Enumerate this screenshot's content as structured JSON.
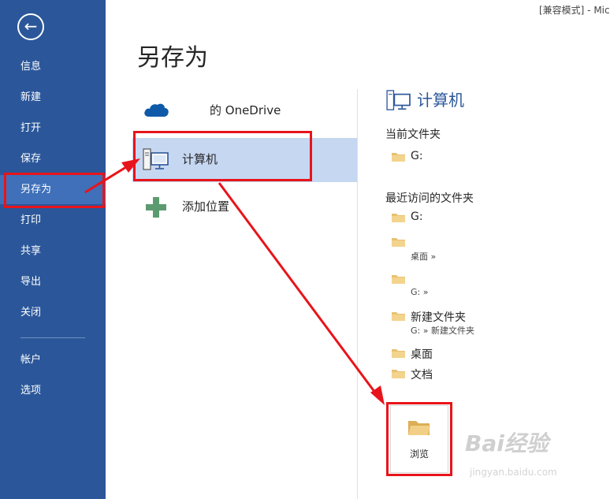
{
  "window": {
    "title": "[兼容模式] - Mic"
  },
  "nav": {
    "back_icon": "back-arrow-icon",
    "items": [
      {
        "label": "信息"
      },
      {
        "label": "新建"
      },
      {
        "label": "打开"
      },
      {
        "label": "保存"
      },
      {
        "label": "另存为"
      },
      {
        "label": "打印"
      },
      {
        "label": "共享"
      },
      {
        "label": "导出"
      },
      {
        "label": "关闭"
      },
      {
        "label": "帐户"
      },
      {
        "label": "选项"
      }
    ],
    "active_item": "另存为"
  },
  "page": {
    "title": "另存为"
  },
  "locations": [
    {
      "label": "的 OneDrive",
      "icon": "onedrive-cloud-icon"
    },
    {
      "label": "计算机",
      "icon": "computer-icon",
      "selected": true
    },
    {
      "label": "添加位置",
      "icon": "plus-icon"
    }
  ],
  "right_panel": {
    "title": "计算机",
    "current_folder_heading": "当前文件夹",
    "current_folder": {
      "name": "G:"
    },
    "recent_heading": "最近访问的文件夹",
    "recent_folders": [
      {
        "name": "G:",
        "path": ""
      },
      {
        "name": "",
        "path": "桌面 »"
      },
      {
        "name": "",
        "path": "G: »"
      },
      {
        "name": "新建文件夹",
        "path": "G: » 新建文件夹"
      },
      {
        "name": "桌面",
        "path": ""
      },
      {
        "name": "文档",
        "path": ""
      }
    ],
    "browse_label": "浏览"
  },
  "watermark": {
    "text": "Bai经验",
    "sub": "jingyan.baidu.com"
  },
  "colors": {
    "nav_bg": "#2b579a",
    "accent": "#2b579a",
    "selected_bg": "#c6d7f1",
    "annotation_red": "#e8141b",
    "folder": "#e8c170"
  }
}
